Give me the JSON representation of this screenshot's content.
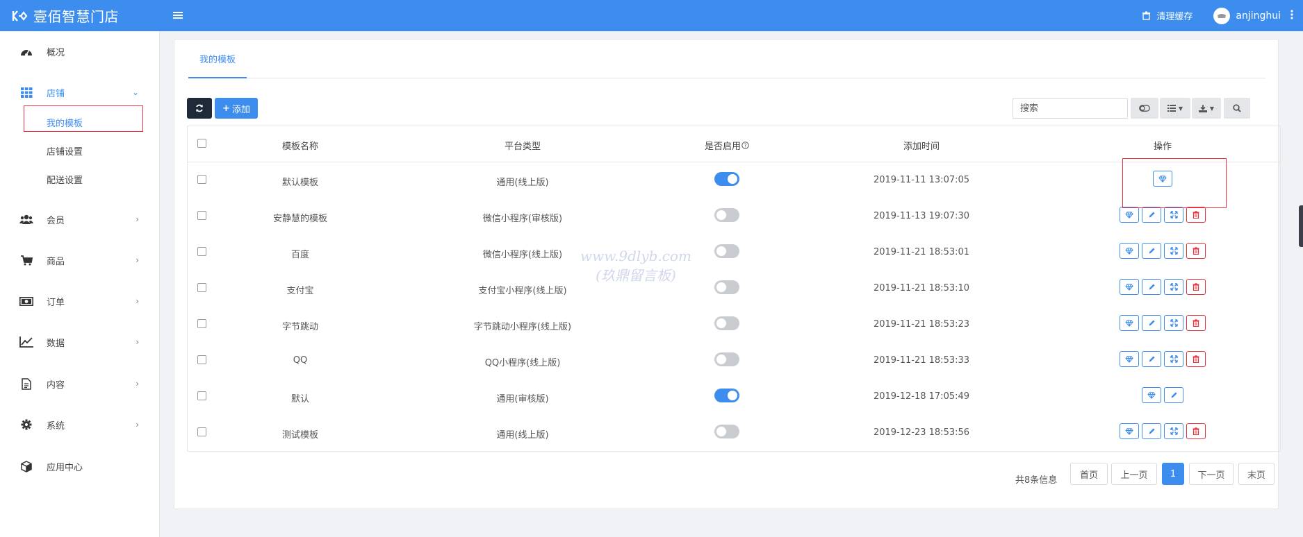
{
  "header": {
    "brand": "壹佰智慧门店",
    "menu_icon": "hamburger-icon",
    "cache_label": "清理缓存",
    "username": "anjinghui"
  },
  "sidebar": {
    "items": [
      {
        "label": "概况",
        "icon": "dashboard-icon"
      },
      {
        "label": "店铺",
        "icon": "grid-icon",
        "chevron": "⌄"
      },
      {
        "label": "会员",
        "icon": "users-icon",
        "chevron": "›"
      },
      {
        "label": "商品",
        "icon": "cart-icon",
        "chevron": "›"
      },
      {
        "label": "订单",
        "icon": "money-icon",
        "chevron": "›"
      },
      {
        "label": "数据",
        "icon": "line-chart-icon",
        "chevron": "›"
      },
      {
        "label": "内容",
        "icon": "document-icon",
        "chevron": "›"
      },
      {
        "label": "系统",
        "icon": "gear-icon",
        "chevron": "›"
      },
      {
        "label": "应用中心",
        "icon": "cube-icon"
      }
    ],
    "sub_items": [
      "我的模板",
      "店铺设置",
      "配送设置"
    ]
  },
  "tab": {
    "label": "我的模板"
  },
  "toolbar": {
    "add_label": "添加",
    "search_placeholder": "搜索"
  },
  "table": {
    "headers": [
      "模板名称",
      "平台类型",
      "是否启用",
      "添加时间",
      "操作"
    ],
    "rows": [
      {
        "name": "默认模板",
        "platform": "通用(线上版)",
        "enabled": true,
        "time": "2019-11-11 13:07:05"
      },
      {
        "name": "安静慧的模板",
        "platform": "微信小程序(审核版)",
        "enabled": false,
        "time": "2019-11-13 19:07:30"
      },
      {
        "name": "百度",
        "platform": "微信小程序(线上版)",
        "enabled": false,
        "time": "2019-11-21 18:53:01"
      },
      {
        "name": "支付宝",
        "platform": "支付宝小程序(线上版)",
        "enabled": false,
        "time": "2019-11-21 18:53:10"
      },
      {
        "name": "字节跳动",
        "platform": "字节跳动小程序(线上版)",
        "enabled": false,
        "time": "2019-11-21 18:53:23"
      },
      {
        "name": "QQ",
        "platform": "QQ小程序(线上版)",
        "enabled": false,
        "time": "2019-11-21 18:53:33"
      },
      {
        "name": "默认",
        "platform": "通用(审核版)",
        "enabled": true,
        "time": "2019-12-18 17:05:49"
      },
      {
        "name": "测试模板",
        "platform": "通用(线上版)",
        "enabled": false,
        "time": "2019-12-23 18:53:56"
      }
    ]
  },
  "pagination": {
    "total_text": "共8条信息",
    "first": "首页",
    "prev": "上一页",
    "current": "1",
    "next": "下一页",
    "last": "末页"
  },
  "watermark": {
    "line1": "www.9dlyb.com",
    "line2": "(玖鼎留言板)"
  },
  "colors": {
    "primary": "#3c8dee",
    "danger": "#e8323c",
    "dark_button": "#1e2a38"
  }
}
